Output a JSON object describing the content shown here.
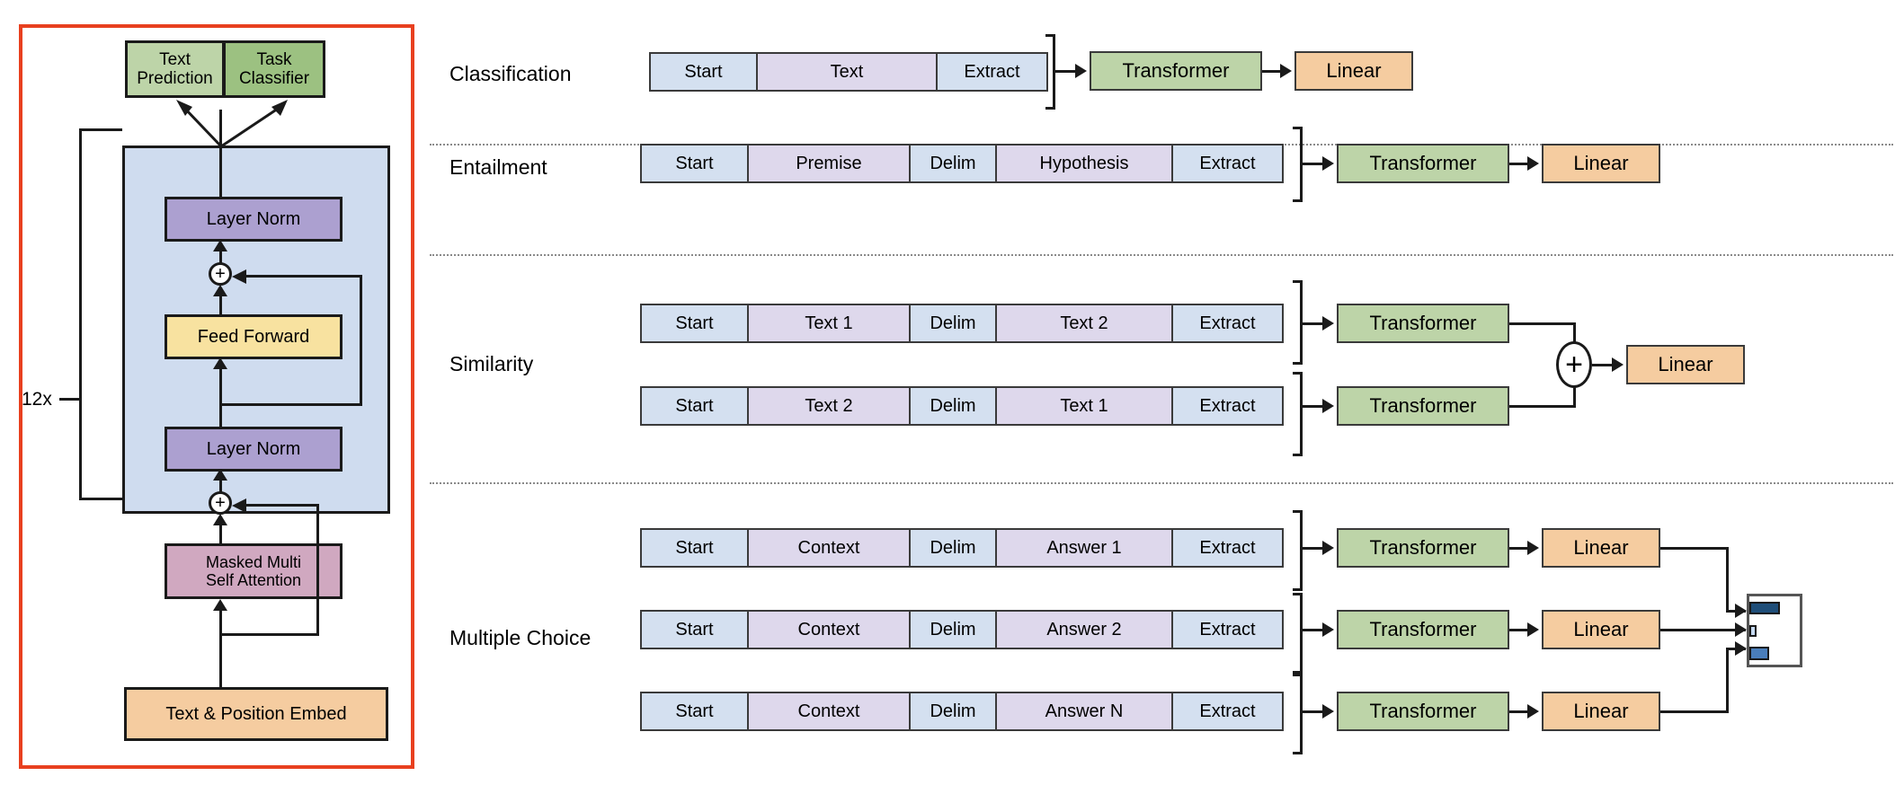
{
  "figure": {
    "title": "GPT Transformer architecture and task-specific input transformations",
    "colors": {
      "panel_border_red": "#e8401f",
      "block_bg_blue": "#cfdcef",
      "layer_norm_purple": "#aca0d0",
      "feed_forward_yellow": "#f8e2a0",
      "attention_pink": "#d0a8c0",
      "embed_orange": "#f5cca0",
      "text_prediction_green": "#bdd4a8",
      "task_classifier_green": "#9cc181",
      "token_special_blue": "#d4e0f0",
      "token_content_purple": "#ded8ec",
      "transformer_green": "#bdd4a8",
      "linear_orange": "#f5cca0",
      "stroke_black": "#1a1a1a",
      "separator_gray": "#8a8a8a"
    }
  },
  "left_panel": {
    "heads": [
      {
        "label": "Text\nPrediction",
        "line1": "Text",
        "line2": "Prediction"
      },
      {
        "label": "Task\nClassifier",
        "line1": "Task",
        "line2": "Classifier"
      }
    ],
    "repeat_label": "12x",
    "blocks": [
      {
        "name": "layer-norm-top",
        "label": "Layer Norm"
      },
      {
        "name": "feed-forward",
        "label": "Feed Forward"
      },
      {
        "name": "layer-norm-bottom",
        "label": "Layer Norm"
      },
      {
        "name": "masked-attention",
        "line1": "Masked Multi",
        "line2": "Self Attention"
      },
      {
        "name": "embedding",
        "label": "Text & Position Embed"
      }
    ],
    "residual_op": "+"
  },
  "right_panel": {
    "tasks": [
      {
        "id": "classification",
        "label": "Classification",
        "rows": [
          {
            "tokens": [
              {
                "text": "Start",
                "kind": "special"
              },
              {
                "text": "Text",
                "kind": "content"
              },
              {
                "text": "Extract",
                "kind": "special"
              }
            ],
            "transformer": "Transformer",
            "linear": "Linear"
          }
        ]
      },
      {
        "id": "entailment",
        "label": "Entailment",
        "rows": [
          {
            "tokens": [
              {
                "text": "Start",
                "kind": "special"
              },
              {
                "text": "Premise",
                "kind": "content"
              },
              {
                "text": "Delim",
                "kind": "special"
              },
              {
                "text": "Hypothesis",
                "kind": "content"
              },
              {
                "text": "Extract",
                "kind": "special"
              }
            ],
            "transformer": "Transformer",
            "linear": "Linear"
          }
        ]
      },
      {
        "id": "similarity",
        "label": "Similarity",
        "combine_op": "+",
        "linear": "Linear",
        "rows": [
          {
            "tokens": [
              {
                "text": "Start",
                "kind": "special"
              },
              {
                "text": "Text 1",
                "kind": "content"
              },
              {
                "text": "Delim",
                "kind": "special"
              },
              {
                "text": "Text 2",
                "kind": "content"
              },
              {
                "text": "Extract",
                "kind": "special"
              }
            ],
            "transformer": "Transformer"
          },
          {
            "tokens": [
              {
                "text": "Start",
                "kind": "special"
              },
              {
                "text": "Text 2",
                "kind": "content"
              },
              {
                "text": "Delim",
                "kind": "special"
              },
              {
                "text": "Text 1",
                "kind": "content"
              },
              {
                "text": "Extract",
                "kind": "special"
              }
            ],
            "transformer": "Transformer"
          }
        ]
      },
      {
        "id": "multiple-choice",
        "label": "Multiple Choice",
        "rows": [
          {
            "tokens": [
              {
                "text": "Start",
                "kind": "special"
              },
              {
                "text": "Context",
                "kind": "content"
              },
              {
                "text": "Delim",
                "kind": "special"
              },
              {
                "text": "Answer 1",
                "kind": "content"
              },
              {
                "text": "Extract",
                "kind": "special"
              }
            ],
            "transformer": "Transformer",
            "linear": "Linear"
          },
          {
            "tokens": [
              {
                "text": "Start",
                "kind": "special"
              },
              {
                "text": "Context",
                "kind": "content"
              },
              {
                "text": "Delim",
                "kind": "special"
              },
              {
                "text": "Answer 2",
                "kind": "content"
              },
              {
                "text": "Extract",
                "kind": "special"
              }
            ],
            "transformer": "Transformer",
            "linear": "Linear"
          },
          {
            "tokens": [
              {
                "text": "Start",
                "kind": "special"
              },
              {
                "text": "Context",
                "kind": "content"
              },
              {
                "text": "Delim",
                "kind": "special"
              },
              {
                "text": "Answer N",
                "kind": "content"
              },
              {
                "text": "Extract",
                "kind": "special"
              }
            ],
            "transformer": "Transformer",
            "linear": "Linear"
          }
        ]
      }
    ]
  },
  "chart_data": {
    "type": "bar",
    "orientation": "horizontal",
    "title": "",
    "xlabel": "",
    "ylabel": "",
    "categories": [
      "Answer 1",
      "Answer 2",
      "Answer N"
    ],
    "values": [
      34,
      8,
      22
    ],
    "xlim": [
      0,
      56
    ],
    "grid": false,
    "legend": false,
    "bar_colors": [
      "#1f4e79",
      "#c5d9f1",
      "#4a7ebb"
    ]
  }
}
